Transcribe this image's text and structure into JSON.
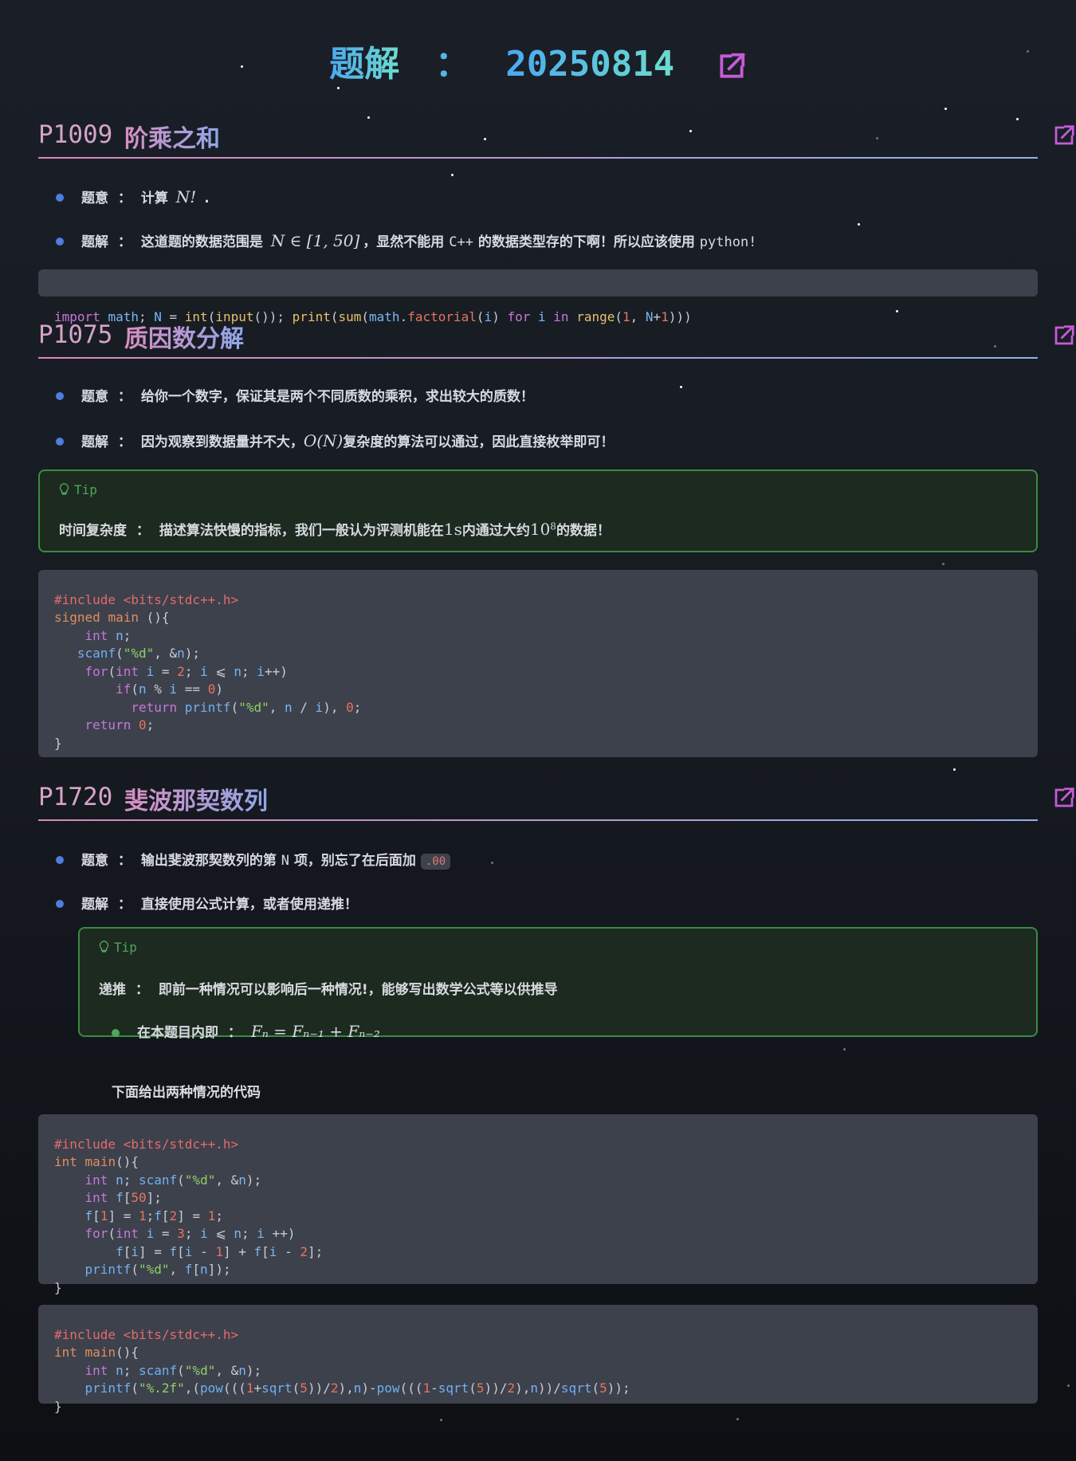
{
  "page": {
    "title_label": "题解",
    "title_sep": "：",
    "title_date": "20250814",
    "open_icon": "external-link-icon"
  },
  "sections": [
    {
      "pid": "P1009",
      "name": "阶乘之和",
      "bullets": [
        {
          "label": "题意",
          "sep": "：",
          "text_pre": "计算",
          "math": "N!",
          "text_post": "."
        },
        {
          "label": "题解",
          "sep": "：",
          "text_pre": "这道题的数据范围是",
          "math": "N ∈ [1, 50]",
          "text_mid": "，显然不能用",
          "code1": "C++",
          "text_mid2": "的数据类型存的下啊！所以应该使用",
          "code2": "python!"
        }
      ],
      "code": [
        "import math; N = int(input()); print(sum(math.factorial(i) for i in range(1, N+1)))"
      ]
    },
    {
      "pid": "P1075",
      "name": "质因数分解",
      "bullets": [
        {
          "label": "题意",
          "sep": "：",
          "text": "给你一个数字，保证其是两个不同质数的乘积，求出较大的质数！"
        },
        {
          "label": "题解",
          "sep": "：",
          "text_pre": "因为观察到数据量并不大，",
          "math": "O(N)",
          "text_post": "复杂度的算法可以通过，因此直接枚举即可！"
        }
      ],
      "tip": {
        "title": "Tip",
        "term": "时间复杂度",
        "sep": "：",
        "text_pre": "描述算法快慢的指标，我们一般认为评测机能在",
        "math1": "1s",
        "text_mid": "内通过大约",
        "math2": "10",
        "sup": "8",
        "text_post": "的数据！"
      },
      "code": [
        "#include <bits/stdc++.h>",
        "signed main (){",
        "    int n;",
        "   scanf(\"%d\", &n);",
        "    for(int i = 2; i ⩽ n; i++)",
        "        if(n % i == 0)",
        "          return printf(\"%d\", n / i), 0;",
        "    return 0;",
        "}"
      ]
    },
    {
      "pid": "P1720",
      "name": "斐波那契数列",
      "bullets": [
        {
          "label": "题意",
          "sep": "：",
          "text_pre": "输出斐波那契数列的第",
          "code1": "N",
          "text_post": "项，别忘了在后面加",
          "inline_code": ".00"
        },
        {
          "label": "题解",
          "sep": "：",
          "text": "直接使用公式计算，或者使用递推！"
        }
      ],
      "tip": {
        "title": "Tip",
        "term": "递推",
        "sep": "：",
        "text": "即前一种情况可以影响后一种情况!，能够写出数学公式等以供推导",
        "sub_label": "在本题目内即",
        "sub_sep": "：",
        "formula": "Fₙ = Fₙ₋₁ + Fₙ₋₂"
      },
      "note": "下面给出两种情况的代码",
      "code": [
        "#include <bits/stdc++.h>",
        "int main(){",
        "    int n; scanf(\"%d\", &n);",
        "    int f[50];",
        "    f[1] = 1;f[2] = 1;",
        "    for(int i = 3; i ⩽ n; i ++)",
        "        f[i] = f[i - 1] + f[i - 2];",
        "    printf(\"%d\", f[n]);",
        "}"
      ],
      "code2": [
        "#include <bits/stdc++.h>",
        "int main(){",
        "    int n; scanf(\"%d\", &n);",
        "    printf(\"%.2f\",(pow(((1+sqrt(5))/2),n)-pow(((1-sqrt(5))/2),n))/sqrt(5));",
        "}"
      ]
    }
  ],
  "colors": {
    "background": "#161a21",
    "code_bg": "#3d414c",
    "tip_border": "#3b8a42",
    "bullet_dot": "#4d7ee0",
    "accent_link": "#c65bd8"
  }
}
